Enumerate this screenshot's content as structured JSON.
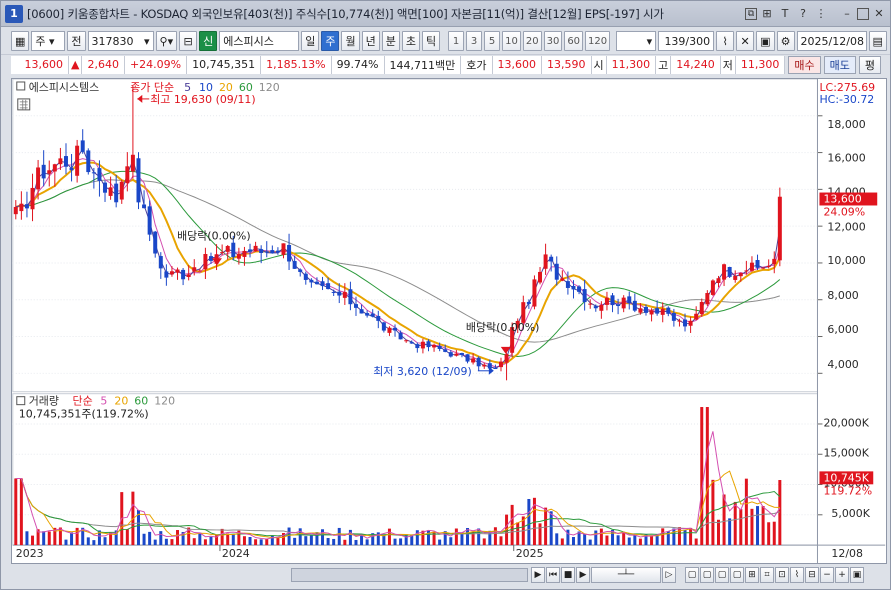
{
  "window": {
    "number": "1",
    "title": "[0600] 키움종합차트 - KOSDAQ 외국인보유[403(천)] 주식수[10,774(천)] 액면[100] 자본금[11(억)] 결산[12월] EPS[-197] 시가"
  },
  "toolbar": {
    "type_value": "주",
    "prev_label": "전",
    "code_value": "317830",
    "sin_label": "신",
    "stock_name": "에스피시스",
    "periods": [
      "일",
      "주",
      "월",
      "년",
      "분",
      "초",
      "틱"
    ],
    "active_period": "주",
    "numbers": [
      "1",
      "3",
      "5",
      "10",
      "20",
      "30",
      "60",
      "120"
    ],
    "count_value": "139/300",
    "date_value": "2025/12/08"
  },
  "infobar": {
    "price": "13,600",
    "change_arrow": "▲",
    "change": "2,640",
    "change_pct": "+24.09%",
    "volume": "10,745,351",
    "volume_ratio": "1,185.13%",
    "ratio2": "99.74%",
    "amount": "144,711백만",
    "quote_label": "호가",
    "ask": "13,600",
    "bid": "13,590",
    "open_label": "시",
    "open": "11,300",
    "high_label": "고",
    "high": "14,240",
    "low_label": "저",
    "low": "11,300",
    "sell_label": "매수",
    "buy_label": "매도",
    "eval_label": "평"
  },
  "price_legend": {
    "name": "에스피시스템스",
    "ma_label": "종가 단순",
    "periods": [
      "5",
      "10",
      "20",
      "60",
      "120"
    ],
    "lc": "LC:275.69",
    "hc": "HC:-30.72"
  },
  "volume_legend": {
    "name": "거래량",
    "ma_label": "단순",
    "periods": [
      "5",
      "20",
      "60",
      "120"
    ],
    "value": "10,745,351주(119.72%)"
  },
  "annotations": {
    "high": "최고 19,630 (09/11)",
    "low": "최저 3,620 (12/09)",
    "dividend": "배당락(0.00%)"
  },
  "price_axis": [
    "18,000",
    "16,000",
    "14,000",
    "12,000",
    "10,000",
    "8,000",
    "6,000",
    "4,000"
  ],
  "volume_axis": [
    "20,000K",
    "15,000K",
    "10,000K",
    "5,000K"
  ],
  "time_axis": [
    "2023",
    "2024",
    "2025",
    "12/08"
  ],
  "badges": {
    "price": "13,600",
    "price_pct": "24.09%",
    "volume": "10,745K",
    "volume_pct": "119.72%"
  },
  "colors": {
    "up": "#e0141e",
    "down": "#1a47c8",
    "ma5": "#4b3f9a",
    "ma10": "#d44fb0",
    "ma20": "#e8a400",
    "ma60": "#2c9a3c",
    "ma120": "#8c8c8c",
    "axis_text": "#2a2a2a"
  },
  "chart_data": {
    "type": "candlestick",
    "price_ylim": [
      3000,
      20000
    ],
    "volume_ylim": [
      0,
      25000
    ],
    "price_ticks": [
      4000,
      6000,
      8000,
      10000,
      12000,
      14000,
      16000,
      18000
    ],
    "volume_ticks": [
      5000,
      10000,
      15000,
      20000
    ],
    "high_point": {
      "value": 19630,
      "date": "09/11"
    },
    "low_point": {
      "value": 3620,
      "date": "12/09"
    },
    "last_close": 13600,
    "last_volume_k": 10745
  }
}
